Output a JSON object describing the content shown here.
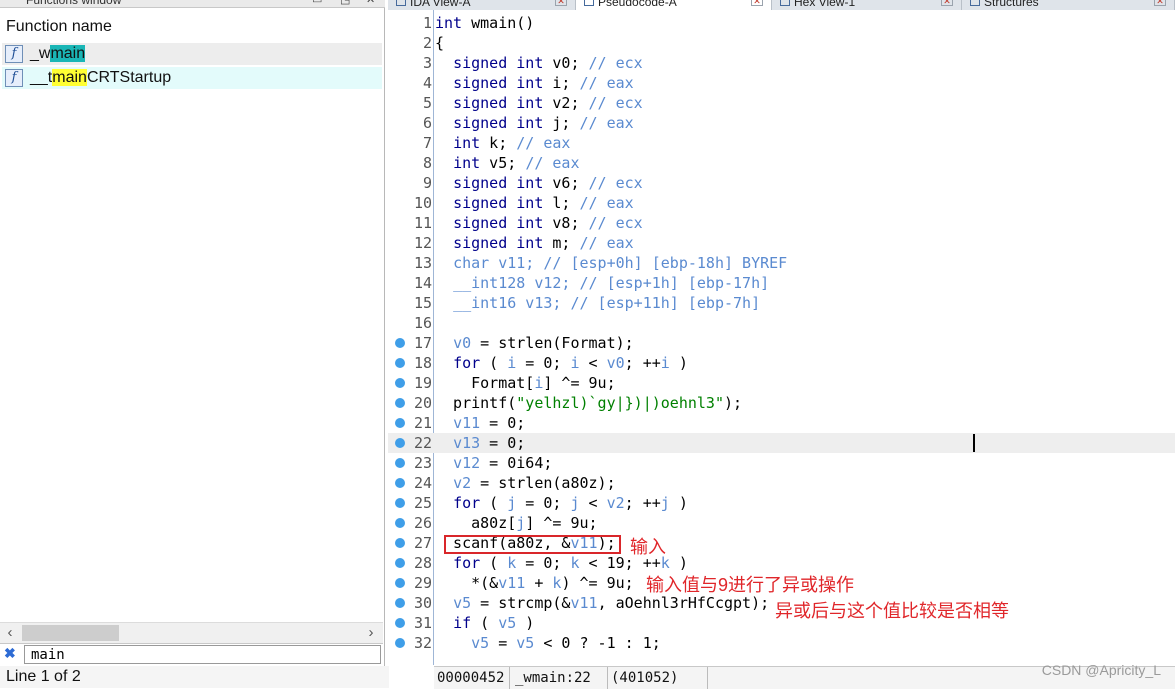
{
  "left_panel": {
    "title": "Functions window",
    "column_header": "Function name",
    "functions": [
      {
        "pre": "_w",
        "hl": "main",
        "post": "",
        "hl_color": "#1ab6b6"
      },
      {
        "pre": "__t",
        "hl": "main",
        "post": "CRTStartup",
        "hl_color": "#ffff33"
      }
    ],
    "search_value": "main",
    "status": "Line 1 of 2"
  },
  "tabs": [
    {
      "label": "IDA View-A"
    },
    {
      "label": "Pseudocode-A"
    },
    {
      "label": "Hex View-1"
    },
    {
      "label": "Structures"
    }
  ],
  "code_lines": [
    {
      "n": "1",
      "dot": false,
      "html": "<span class=\"k\">int</span> wmain()"
    },
    {
      "n": "2",
      "dot": false,
      "html": "{"
    },
    {
      "n": "3",
      "dot": false,
      "html": "  <span class=\"k\">signed int</span> v0; <span class=\"g\">// ecx</span>"
    },
    {
      "n": "4",
      "dot": false,
      "html": "  <span class=\"k\">signed int</span> i; <span class=\"g\">// eax</span>"
    },
    {
      "n": "5",
      "dot": false,
      "html": "  <span class=\"k\">signed int</span> v2; <span class=\"g\">// ecx</span>"
    },
    {
      "n": "6",
      "dot": false,
      "html": "  <span class=\"k\">signed int</span> j; <span class=\"g\">// eax</span>"
    },
    {
      "n": "7",
      "dot": false,
      "html": "  <span class=\"k\">int</span> k; <span class=\"g\">// eax</span>"
    },
    {
      "n": "8",
      "dot": false,
      "html": "  <span class=\"k\">int</span> v5; <span class=\"g\">// eax</span>"
    },
    {
      "n": "9",
      "dot": false,
      "html": "  <span class=\"k\">signed int</span> v6; <span class=\"g\">// ecx</span>"
    },
    {
      "n": "10",
      "dot": false,
      "html": "  <span class=\"k\">signed int</span> l; <span class=\"g\">// eax</span>"
    },
    {
      "n": "11",
      "dot": false,
      "html": "  <span class=\"k\">signed int</span> v8; <span class=\"g\">// ecx</span>"
    },
    {
      "n": "12",
      "dot": false,
      "html": "  <span class=\"k\">signed int</span> m; <span class=\"g\">// eax</span>"
    },
    {
      "n": "13",
      "dot": false,
      "html": "  <span class=\"g\">char v11; // [esp+0h] [ebp-18h] BYREF</span>"
    },
    {
      "n": "14",
      "dot": false,
      "html": "  <span class=\"g\">__int128 v12; // [esp+1h] [ebp-17h]</span>"
    },
    {
      "n": "15",
      "dot": false,
      "html": "  <span class=\"g\">__int16 v13; // [esp+11h] [ebp-7h]</span>"
    },
    {
      "n": "16",
      "dot": false,
      "html": ""
    },
    {
      "n": "17",
      "dot": true,
      "html": "  <span class=\"g\">v0</span> = strlen(Format);"
    },
    {
      "n": "18",
      "dot": true,
      "html": "  <span class=\"k\">for</span> ( <span class=\"g\">i</span> = 0; <span class=\"g\">i</span> &lt; <span class=\"g\">v0</span>; ++<span class=\"g\">i</span> )"
    },
    {
      "n": "19",
      "dot": true,
      "html": "    Format[<span class=\"g\">i</span>] ^= 9u;"
    },
    {
      "n": "20",
      "dot": true,
      "html": "  printf(<span class=\"s\">\"yelhzl)`gy|})|)oehnl3\"</span>);"
    },
    {
      "n": "21",
      "dot": true,
      "html": "  <span class=\"g\">v11</span> = 0;"
    },
    {
      "n": "22",
      "dot": true,
      "current": true,
      "html": "  <span class=\"g\">v13</span> = 0;"
    },
    {
      "n": "23",
      "dot": true,
      "html": "  <span class=\"g\">v12</span> = 0i64;"
    },
    {
      "n": "24",
      "dot": true,
      "html": "  <span class=\"g\">v2</span> = strlen(a80z);"
    },
    {
      "n": "25",
      "dot": true,
      "html": "  <span class=\"k\">for</span> ( <span class=\"g\">j</span> = 0; <span class=\"g\">j</span> &lt; <span class=\"g\">v2</span>; ++<span class=\"g\">j</span> )"
    },
    {
      "n": "26",
      "dot": true,
      "html": "    a80z[<span class=\"g\">j</span>] ^= 9u;"
    },
    {
      "n": "27",
      "dot": true,
      "html": "  scanf(a80z, &amp;<span class=\"g\">v11</span>);"
    },
    {
      "n": "28",
      "dot": true,
      "html": "  <span class=\"k\">for</span> ( <span class=\"g\">k</span> = 0; <span class=\"g\">k</span> &lt; 19; ++<span class=\"g\">k</span> )"
    },
    {
      "n": "29",
      "dot": true,
      "html": "    *(&amp;<span class=\"g\">v11</span> + <span class=\"g\">k</span>) ^= 9u;"
    },
    {
      "n": "30",
      "dot": true,
      "html": "  <span class=\"g\">v5</span> = strcmp(&amp;<span class=\"g\">v11</span>, aOehnl3rHfCcgpt);"
    },
    {
      "n": "31",
      "dot": true,
      "html": "  <span class=\"k\">if</span> ( <span class=\"g\">v5</span> )"
    },
    {
      "n": "32",
      "dot": true,
      "html": "    <span class=\"g\">v5</span> = <span class=\"g\">v5</span> &lt; 0 ? -1 : 1;"
    }
  ],
  "annotations": {
    "input": "输入",
    "xor_note": "输入值与9进行了异或操作",
    "compare_note": "异或后与这个值比较是否相等"
  },
  "status_bar": {
    "offset": "00000452",
    "location": "_wmain:22",
    "address": "(401052)"
  },
  "watermark": "CSDN @Apricity_L",
  "colors": {
    "accent": "#3f9ee8",
    "annotation": "#e0262a",
    "keyword": "#00008b",
    "variable": "#5a8ad0",
    "string": "#008000"
  }
}
